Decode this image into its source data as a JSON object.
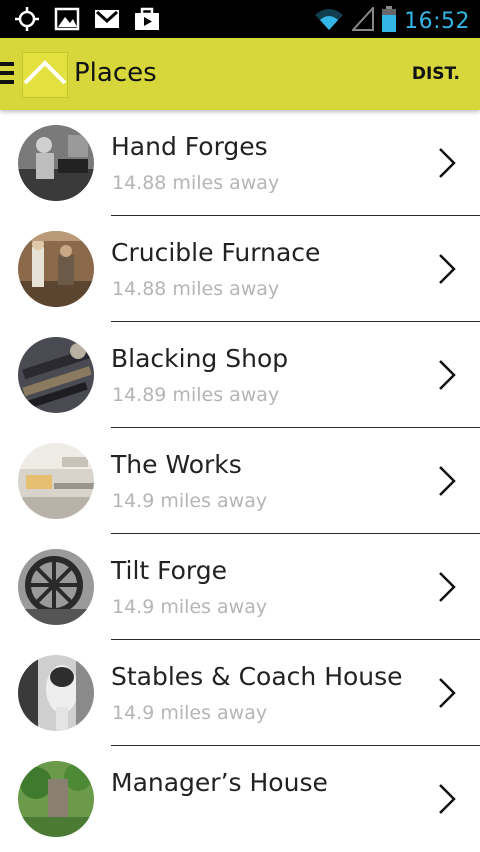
{
  "status": {
    "time": "16:52"
  },
  "header": {
    "title": "Places",
    "sort_label": "DIST."
  },
  "colors": {
    "accent": "#d7d63b",
    "status_blue": "#33b5e5"
  },
  "places": [
    {
      "name": "Hand Forges",
      "distance": "14.88 miles away"
    },
    {
      "name": "Crucible Furnace",
      "distance": "14.88 miles away"
    },
    {
      "name": "Blacking Shop",
      "distance": "14.89 miles away"
    },
    {
      "name": "The Works",
      "distance": "14.9 miles away"
    },
    {
      "name": "Tilt Forge",
      "distance": "14.9 miles away"
    },
    {
      "name": "Stables & Coach House",
      "distance": "14.9 miles away"
    },
    {
      "name": "Manager’s House",
      "distance": ""
    }
  ]
}
